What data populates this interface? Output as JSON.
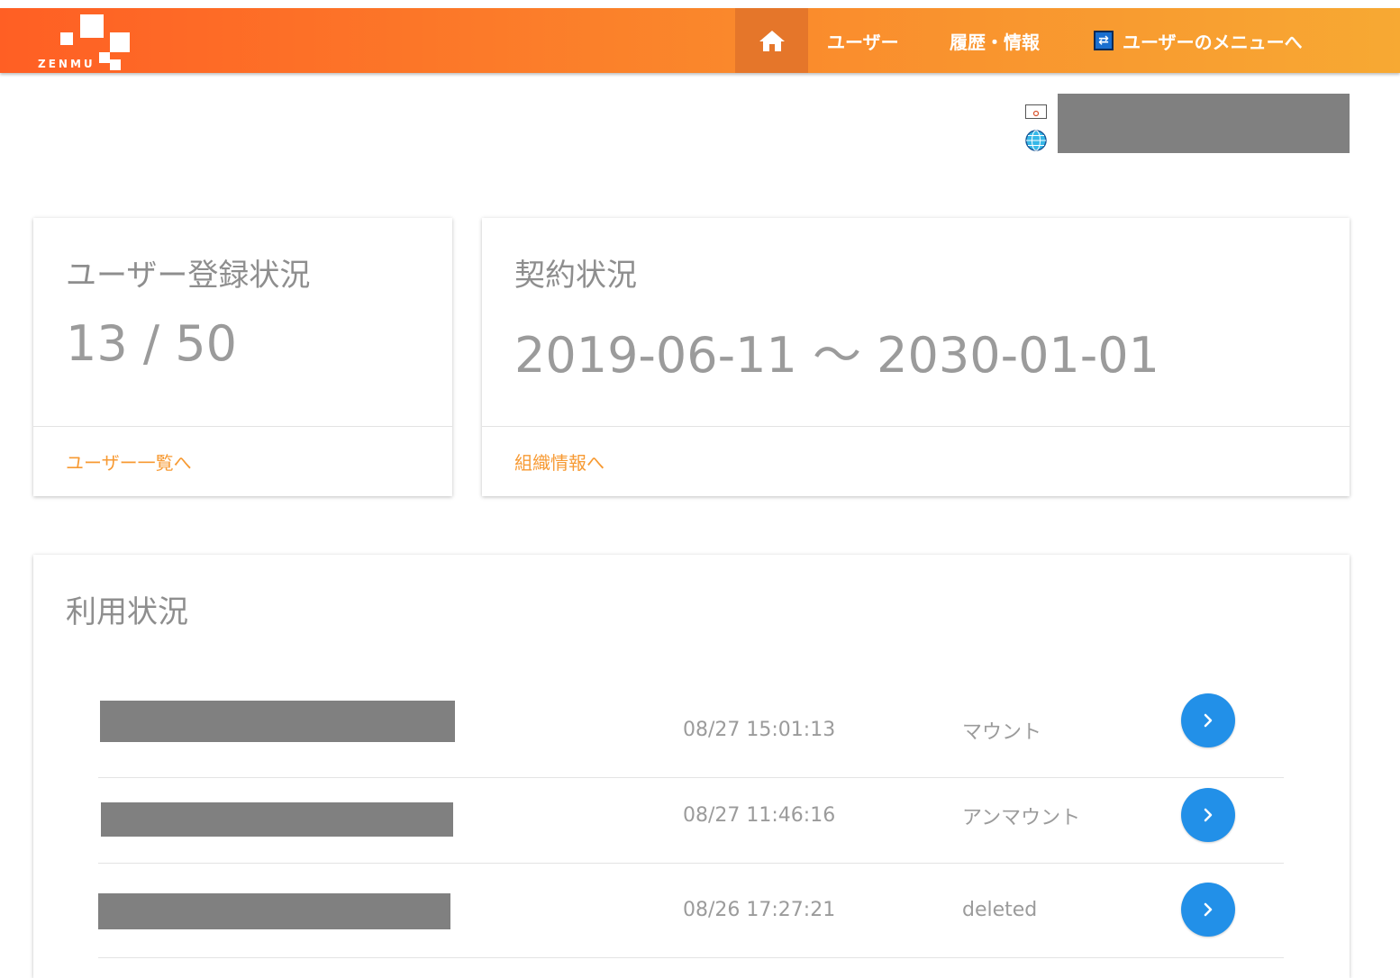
{
  "brand": {
    "logo_text": "ZENMU"
  },
  "nav": {
    "home_icon": "home-icon",
    "users": "ユーザー",
    "history": "履歴・情報",
    "user_menu": "ユーザーのメニューへ",
    "user_menu_icon": "sync-icon"
  },
  "colors": {
    "header_start": "#ff5f24",
    "header_end": "#f7a933",
    "active_nav": "#e5762a",
    "link": "#f79a33",
    "action_button": "#2290e8"
  },
  "registration": {
    "title": "ユーザー登録状況",
    "value": "13 / 50",
    "link": "ユーザー一覧へ"
  },
  "contract": {
    "title": "契約状況",
    "value": "2019-06-11 ～ 2030-01-01",
    "link": "組織情報へ"
  },
  "usage": {
    "title": "利用状況",
    "rows": [
      {
        "time": "08/27 15:01:13",
        "action": "マウント"
      },
      {
        "time": "08/27 11:46:16",
        "action": "アンマウント"
      },
      {
        "time": "08/26 17:27:21",
        "action": "deleted"
      }
    ]
  }
}
